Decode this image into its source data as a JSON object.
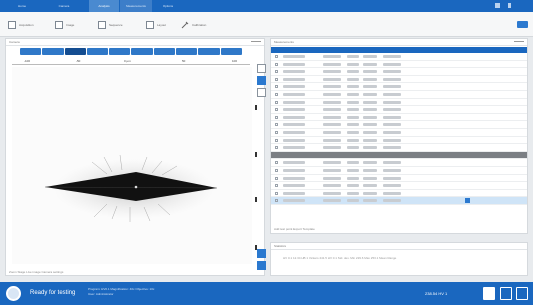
{
  "nav": {
    "tabs": [
      "Home",
      "Camera",
      "Analysis",
      "Measurements",
      "Options"
    ],
    "active_index": 2
  },
  "toolbar": {
    "items": [
      "Acquisition",
      "Image",
      "Sequence",
      "Layout",
      "Calibration"
    ]
  },
  "left_panel": {
    "title": "Camera",
    "ruler_ticks": [
      "-100",
      "-50",
      "0 µm",
      "50",
      "100"
    ],
    "footer": "Zoom   Stage   Live image   Camera settings"
  },
  "right_panel": {
    "title": "Measurements",
    "footer": "Add test point   Export   Template",
    "rows": [
      {
        "kind": "row"
      },
      {
        "kind": "row"
      },
      {
        "kind": "row"
      },
      {
        "kind": "row"
      },
      {
        "kind": "row"
      },
      {
        "kind": "row"
      },
      {
        "kind": "row"
      },
      {
        "kind": "row"
      },
      {
        "kind": "row"
      },
      {
        "kind": "row"
      },
      {
        "kind": "row"
      },
      {
        "kind": "row"
      },
      {
        "kind": "row"
      },
      {
        "kind": "sep"
      },
      {
        "kind": "row"
      },
      {
        "kind": "row"
      },
      {
        "kind": "row"
      },
      {
        "kind": "row"
      },
      {
        "kind": "row"
      },
      {
        "kind": "sel"
      }
    ]
  },
  "bottom_panel": {
    "title": "Statistics",
    "text": "HV 0.1  12.34 HB 1   Vickers   241.5 HV 0.1   Std. dev.   Min 229.6   Max 253.1   Mean   Range"
  },
  "status": {
    "text": "Ready for testing",
    "info_line1": "Program: HV0.1  Magnification: 40x   Objective: 10x",
    "info_line2": "User: Administrator",
    "measure": "238.54 HV 1"
  }
}
